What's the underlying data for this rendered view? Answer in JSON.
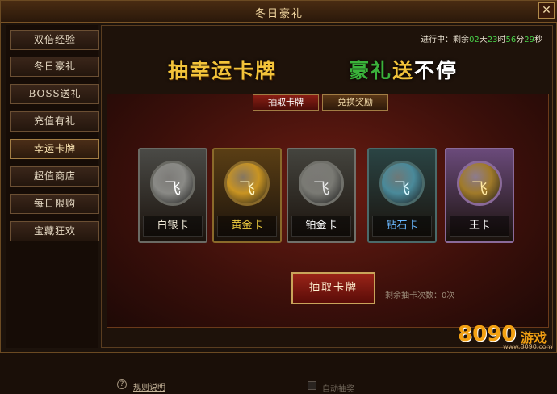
{
  "window": {
    "title": "冬日豪礼",
    "close_glyph": "✕"
  },
  "sidebar": {
    "items": [
      {
        "label": "双倍经验"
      },
      {
        "label": "冬日豪礼"
      },
      {
        "label": "BOSS送礼"
      },
      {
        "label": "充值有礼"
      },
      {
        "label": "幸运卡牌"
      },
      {
        "label": "超值商店"
      },
      {
        "label": "每日限购"
      },
      {
        "label": "宝藏狂欢"
      }
    ],
    "active_index": 4
  },
  "timer": {
    "prefix": "进行中：剩余",
    "days": "02",
    "d_unit": "天",
    "hours": "23",
    "h_unit": "时",
    "minutes": "56",
    "m_unit": "分",
    "seconds": "29",
    "s_unit": "秒"
  },
  "banner": {
    "left": "抽幸运卡牌",
    "right_g": "豪礼",
    "right_y": "送",
    "right_w": "不停"
  },
  "tabs": [
    {
      "label": "抽取卡牌"
    },
    {
      "label": "兑换奖励"
    }
  ],
  "cards": [
    {
      "label": "白银卡",
      "label_color": "#f0ead8",
      "frame": "#6a6a64",
      "bg": "#4a4a46",
      "medal": "#8a8a86",
      "glyph_color": "#ffffff"
    },
    {
      "label": "黄金卡",
      "label_color": "#f2d040",
      "frame": "#8a6a2a",
      "bg": "#5a3e14",
      "medal": "#c99422",
      "glyph_color": "#fff6c0"
    },
    {
      "label": "铂金卡",
      "label_color": "#ffffff",
      "frame": "#70706a",
      "bg": "#44443e",
      "medal": "#7a7a74",
      "glyph_color": "#e8e8e8"
    },
    {
      "label": "钻石卡",
      "label_color": "#6ab8ff",
      "frame": "#4a6a6a",
      "bg": "#2a4444",
      "medal": "#4a8a9a",
      "glyph_color": "#d8f8ff"
    },
    {
      "label": "王卡",
      "label_color": "#ffffff",
      "frame": "#8a6a9a",
      "bg": "#6a4a7a",
      "medal": "#a07a2a",
      "glyph_color": "#ffe8a0"
    }
  ],
  "card_glyph": "飞",
  "draw_button": {
    "label": "抽取卡牌"
  },
  "remaining": {
    "label": "剩余抽卡次数：0次"
  },
  "rules": {
    "label": "规则说明",
    "icon": "?"
  },
  "auto_draw": {
    "label": "自动抽奖"
  },
  "watermark": {
    "number": "8090",
    "text": "游戏",
    "url": "www.8090.com"
  }
}
